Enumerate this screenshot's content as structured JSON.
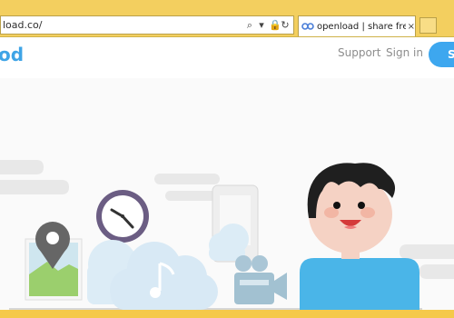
{
  "browser": {
    "address": "load.co/",
    "tab_title": "openload | share free witho...",
    "tab_close": "×"
  },
  "site": {
    "logo_text": "od",
    "nav": {
      "support": "Support",
      "signin": "Sign in",
      "signup": "S"
    },
    "colors": {
      "accent": "#3da7ef",
      "header_text": "#8d8d8d",
      "browser_frame": "#f5c94a"
    }
  },
  "icons": {
    "search": "search-icon",
    "lock": "lock-icon",
    "refresh": "refresh-icon",
    "dropdown": "dropdown-icon",
    "site": "openload-icon"
  }
}
